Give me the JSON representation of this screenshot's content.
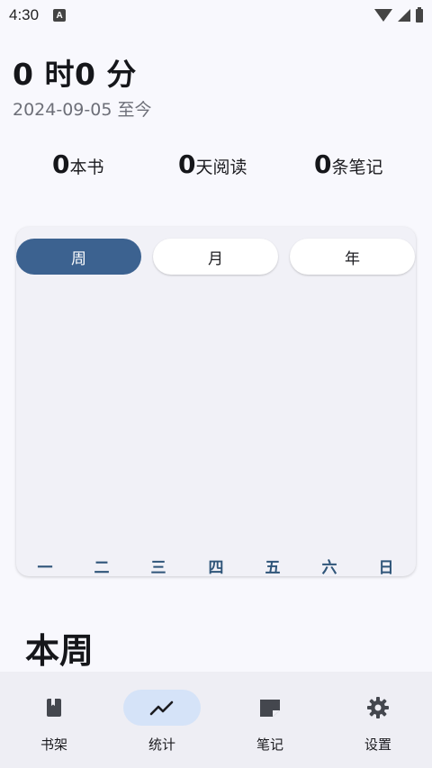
{
  "status_bar": {
    "time": "4:30",
    "notification_icon": "a-icon",
    "icons": [
      "wifi-icon",
      "signal-icon",
      "battery-icon"
    ]
  },
  "summary": {
    "total_time": "0 时0 分",
    "since": "2024-09-05 至今",
    "stats": [
      {
        "value": "0",
        "label": "本书"
      },
      {
        "value": "0",
        "label": "天阅读"
      },
      {
        "value": "0",
        "label": "条笔记"
      }
    ]
  },
  "chart": {
    "tabs": [
      {
        "label": "周",
        "active": true
      },
      {
        "label": "月",
        "active": false
      },
      {
        "label": "年",
        "active": false
      }
    ],
    "day_labels": [
      "一",
      "二",
      "三",
      "四",
      "五",
      "六",
      "日"
    ],
    "accent_color": "#3c6290",
    "chart_data": {
      "type": "bar",
      "categories": [
        "一",
        "二",
        "三",
        "四",
        "五",
        "六",
        "日"
      ],
      "values": [
        0,
        0,
        0,
        0,
        0,
        0,
        0
      ]
    }
  },
  "section": {
    "title": "本周"
  },
  "bottom_nav": {
    "items": [
      {
        "label": "书架",
        "icon": "book-icon",
        "active": false
      },
      {
        "label": "统计",
        "icon": "trending-up-icon",
        "active": true
      },
      {
        "label": "笔记",
        "icon": "note-icon",
        "active": false
      },
      {
        "label": "设置",
        "icon": "gear-icon",
        "active": false
      }
    ]
  }
}
